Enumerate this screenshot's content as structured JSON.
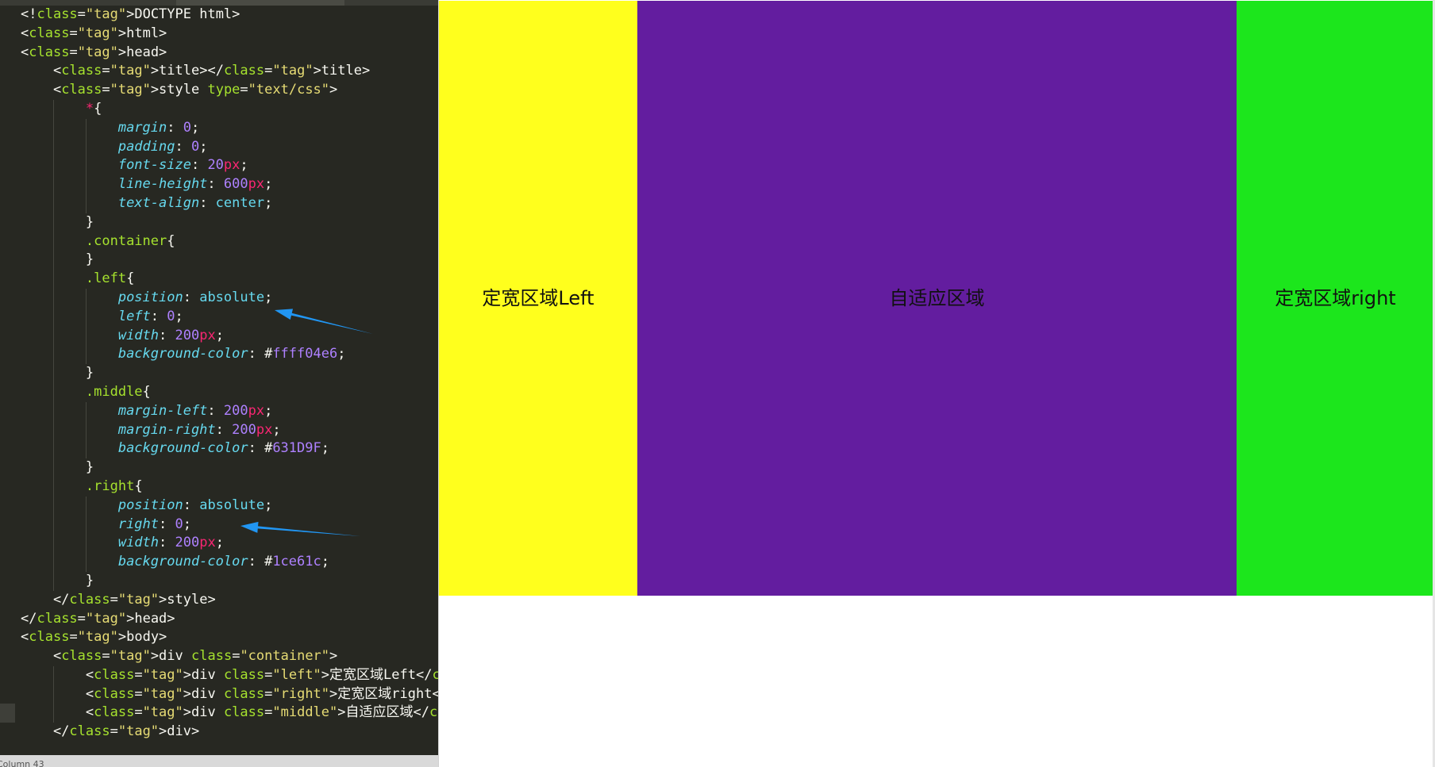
{
  "editor": {
    "code_lines": [
      "<!DOCTYPE html>",
      "<html>",
      "<head>",
      "    <title></title>",
      "    <style type=\"text/css\">",
      "        *{",
      "            margin: 0;",
      "            padding: 0;",
      "            font-size: 20px;",
      "            line-height: 600px;",
      "            text-align: center;",
      "        }",
      "        .container{",
      "        }",
      "        .left{",
      "            position: absolute;",
      "            left: 0;",
      "            width: 200px;",
      "            background-color: #ffff04e6;",
      "        }",
      "        .middle{",
      "            margin-left: 200px;",
      "            margin-right: 200px;",
      "            background-color: #631D9F;",
      "        }",
      "        .right{",
      "            position: absolute;",
      "            right: 0;",
      "            width: 200px;",
      "            background-color: #1ce61c;",
      "        }",
      "    </style>",
      "</head>",
      "<body>",
      "    <div class=\"container\">",
      "        <div class=\"left\">定宽区域Left</div>",
      "        <div class=\"right\">定宽区域right</div>",
      "        <div class=\"middle\">自适应区域</div>",
      "    </div>"
    ],
    "active_line": 37,
    "status_text": "Column 43"
  },
  "preview": {
    "left_label": "定宽区域Left",
    "middle_label": "自适应区域",
    "right_label": "定宽区域right",
    "left_color": "#ffff04e6",
    "middle_color": "#631D9F",
    "right_color": "#1ce61c"
  },
  "annotations": {
    "arrow_color": "#2196f3"
  }
}
